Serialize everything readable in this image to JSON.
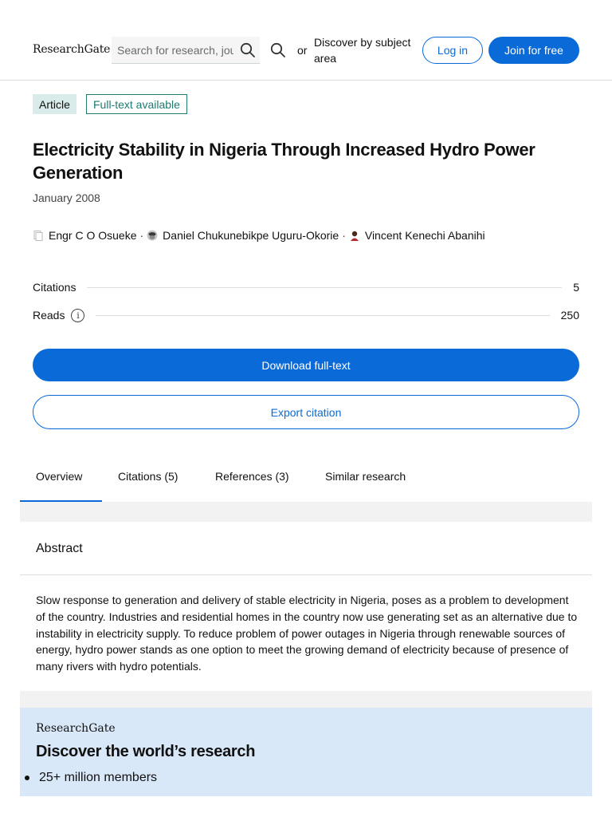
{
  "header": {
    "logo": "ResearchGate",
    "search_placeholder": "Search for research, journals, people, etc.",
    "or_text": "or",
    "discover_link": "Discover by subject area",
    "login_label": "Log in",
    "join_label": "Join for free"
  },
  "article": {
    "type_badge": "Article",
    "fulltext_badge": "Full-text available",
    "title": "Electricity Stability in Nigeria Through Increased Hydro Power Generation",
    "date": "January 2008",
    "authors": [
      {
        "name": "Engr C O Osueke",
        "icon": "placeholder-avatar-icon"
      },
      {
        "name": "Daniel Chukunebikpe Uguru-Okorie",
        "icon": "avatar-photo-icon"
      },
      {
        "name": "Vincent Kenechi Abanihi",
        "icon": "avatar-photo-icon"
      }
    ],
    "author_separator": "·"
  },
  "stats": {
    "citations_label": "Citations",
    "citations_value": "5",
    "reads_label": "Reads",
    "reads_info_icon": "info-icon",
    "reads_value": "250"
  },
  "actions": {
    "download_label": "Download full-text",
    "export_label": "Export citation"
  },
  "tabs": [
    {
      "label": "Overview",
      "active": true
    },
    {
      "label": "Citations (5)",
      "active": false
    },
    {
      "label": "References (3)",
      "active": false
    },
    {
      "label": "Similar research",
      "active": false
    }
  ],
  "abstract": {
    "heading": "Abstract",
    "text": "Slow response to generation and delivery of stable electricity in Nigeria, poses as a problem to development of the country. Industries and residential homes in the country now use generating set as an alternative due to instability in electricity supply. To reduce problem of power outages in Nigeria through renewable sources of energy, hydro power stands as one option to meet the growing demand of electricity because of presence of many rivers with hydro potentials."
  },
  "promo": {
    "logo": "ResearchGate",
    "title": "Discover the world’s research",
    "bullets": [
      "25+ million members"
    ]
  },
  "colors": {
    "primary": "#0a6bd8",
    "article_badge_bg": "#d9ece9",
    "fulltext_badge": "#1f7a70",
    "promo_bg": "#d8e8f8"
  }
}
